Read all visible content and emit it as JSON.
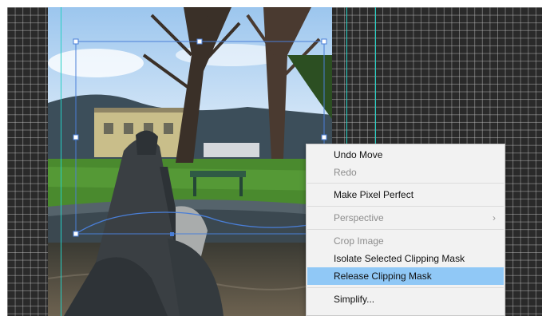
{
  "context_menu": {
    "items": [
      {
        "label": "Undo Move",
        "enabled": true
      },
      {
        "label": "Redo",
        "enabled": false
      },
      {
        "label": "Make Pixel Perfect",
        "enabled": true
      },
      {
        "label": "Perspective",
        "enabled": false,
        "submenu": true
      },
      {
        "label": "Crop Image",
        "enabled": false
      },
      {
        "label": "Isolate Selected Clipping Mask",
        "enabled": true
      },
      {
        "label": "Release Clipping Mask",
        "enabled": true,
        "highlighted": true
      },
      {
        "label": "Simplify...",
        "enabled": true
      }
    ],
    "submenu_chevron": "chevron-right-icon"
  },
  "colors": {
    "artboard": "#2a2a2a",
    "guide": "#25d0c4",
    "selection": "#4a7fd8",
    "highlight": "#90c8f6"
  }
}
